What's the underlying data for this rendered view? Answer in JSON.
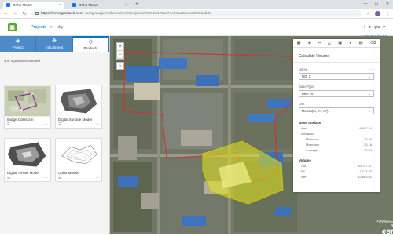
{
  "browser": {
    "tabs": [
      {
        "title": "Ortho Maker",
        "active": true
      },
      {
        "title": "Ortho Maker",
        "active": false
      }
    ],
    "url_host": "https://www.gisstack.com",
    "url_path": "/arcgis/apps/orthomaker/#/projects/56894d478aa74e34ba25e6ad3961ab3a"
  },
  "app": {
    "breadcrumb_root": "Projects",
    "separator": ">",
    "project_name": "kky",
    "username": "gis"
  },
  "left_panel": {
    "tabs": [
      {
        "label": "Project",
        "icon": "◈",
        "active": false
      },
      {
        "label": "Adjustment",
        "icon": "✥",
        "active": false
      },
      {
        "label": "Products",
        "icon": "◇",
        "active": true
      }
    ],
    "count_text": "4 of 4 products created",
    "add_product": "+ Add Product ▾",
    "products": [
      {
        "name": "Image Collection"
      },
      {
        "name": "Digital Surface Model"
      },
      {
        "name": "Digital Terrain Model"
      },
      {
        "name": "Ortho Mosaic"
      }
    ]
  },
  "calc": {
    "title": "Calculate Volume",
    "name_label": "Name",
    "name_value": "ROI 2",
    "base_type_label": "Base Type",
    "base_type_value": "Best Fit",
    "unit_label": "Unit",
    "unit_value": "Meters(m, m², m³)",
    "base_surface_title": "Base Surface",
    "area_label": "Area",
    "area_value": "9,497.44",
    "elevation_label": "Elevation",
    "min_label": "Minimum",
    "min_value": "20.40",
    "max_label": "Maximum",
    "max_value": "30.16",
    "avg_label": "Average",
    "avg_value": "25.34",
    "volume_title": "Volume",
    "cut_label": "Cut",
    "cut_value": "19,727.37",
    "fill_label": "Fill",
    "fill_value": "7,123.45",
    "net_label": "Net",
    "net_value": "12,603.92"
  },
  "map": {
    "zoom_in": "+",
    "zoom_out": "−",
    "home": "⌂",
    "credit": "POWERED BY",
    "brand": "esri"
  }
}
